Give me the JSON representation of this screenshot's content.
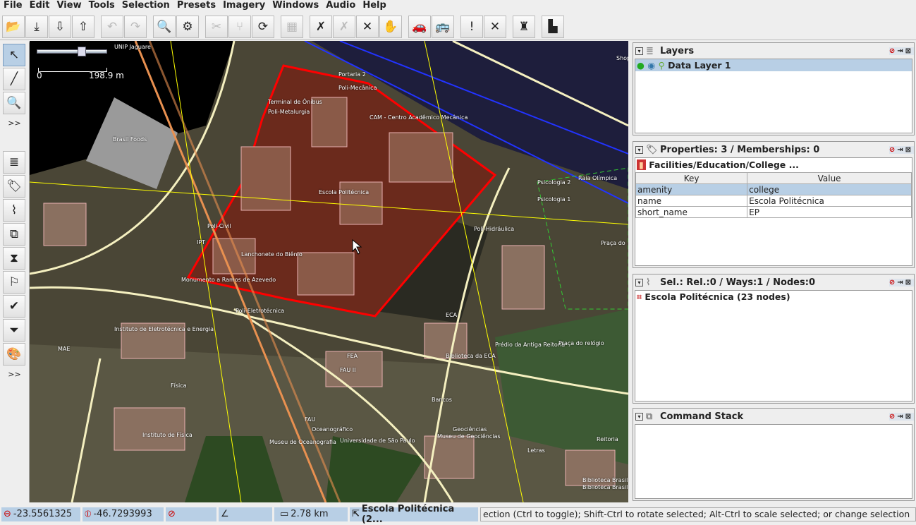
{
  "menu": [
    "File",
    "Edit",
    "View",
    "Tools",
    "Selection",
    "Presets",
    "Imagery",
    "Windows",
    "Audio",
    "Help"
  ],
  "toolbar": [
    {
      "icon": "open-file-icon",
      "g": "📂"
    },
    {
      "icon": "download-icon",
      "g": "⤓"
    },
    {
      "icon": "download-data-icon",
      "g": "⇩"
    },
    {
      "icon": "upload-icon",
      "g": "⇧"
    },
    {
      "sep": true
    },
    {
      "icon": "undo-icon",
      "g": "↶",
      "dis": true
    },
    {
      "icon": "redo-icon",
      "g": "↷",
      "dis": true
    },
    {
      "sep": true
    },
    {
      "icon": "zoom-to-data-icon",
      "g": "🔍"
    },
    {
      "icon": "preferences-icon",
      "g": "⚙"
    },
    {
      "sep": true
    },
    {
      "icon": "split-way-icon",
      "g": "✂",
      "dis": true
    },
    {
      "icon": "combine-way-icon",
      "g": "⑂",
      "dis": true
    },
    {
      "icon": "update-data-icon",
      "g": "⟳"
    },
    {
      "sep": true
    },
    {
      "icon": "disabled-icon",
      "g": "▦",
      "dis": true
    },
    {
      "sep": true
    },
    {
      "icon": "highway-icon",
      "g": "✗"
    },
    {
      "icon": "highway-grey-icon",
      "g": "✗",
      "dis": true
    },
    {
      "icon": "junction-icon",
      "g": "✕"
    },
    {
      "icon": "hand-icon",
      "g": "✋"
    },
    {
      "sep": true
    },
    {
      "icon": "car-icon",
      "g": "🚗"
    },
    {
      "icon": "bus-icon",
      "g": "🚌"
    },
    {
      "sep": true
    },
    {
      "icon": "warning-icon",
      "g": "!"
    },
    {
      "icon": "restaurant-icon",
      "g": "✕"
    },
    {
      "sep": true
    },
    {
      "icon": "castle-icon",
      "g": "♜"
    },
    {
      "sep": true
    },
    {
      "icon": "factory-icon",
      "g": "▙"
    }
  ],
  "left_toolbar": [
    {
      "icon": "select-mode-icon",
      "g": "↖",
      "sel": true
    },
    {
      "icon": "draw-mode-icon",
      "g": "╱"
    },
    {
      "icon": "zoom-mode-icon",
      "g": "🔍"
    },
    {
      "more": ">>"
    },
    {
      "icon": "layers-toggle-icon",
      "g": "≣"
    },
    {
      "icon": "properties-toggle-icon",
      "g": "🏷"
    },
    {
      "icon": "selection-list-icon",
      "g": "⌇"
    },
    {
      "icon": "relations-icon",
      "g": "⧉"
    },
    {
      "icon": "history-icon",
      "g": "⧗"
    },
    {
      "icon": "conflict-icon",
      "g": "⚐"
    },
    {
      "icon": "validator-icon",
      "g": "✔"
    },
    {
      "icon": "filter-icon",
      "g": "⏷"
    },
    {
      "icon": "map-paint-icon",
      "g": "🎨"
    },
    {
      "more": ">>"
    }
  ],
  "map": {
    "scale": {
      "zero": "0",
      "value": "198.9 m"
    },
    "labels": [
      {
        "t": "UNIP Jaguare"
      },
      {
        "t": "Brasil Foods"
      },
      {
        "t": "Portaria 2"
      },
      {
        "t": "Poli-Mecânica"
      },
      {
        "t": "Terminal de Ônibus"
      },
      {
        "t": "Poli-Metalurgia"
      },
      {
        "t": "CAM - Centro Acadêmico Mecânica"
      },
      {
        "t": "Escola Politécnica"
      },
      {
        "t": "Poli-Civil"
      },
      {
        "t": "IPT"
      },
      {
        "t": "Lanchonete do Biênio"
      },
      {
        "t": "Monumento a Ramos de Azevedo"
      },
      {
        "t": "Poli-Eletrotécnica"
      },
      {
        "t": "Instituto de Eletrotécnica e Energia"
      },
      {
        "t": "MAE"
      },
      {
        "t": "FEA"
      },
      {
        "t": "FAU II"
      },
      {
        "t": "Física"
      },
      {
        "t": "ECA"
      },
      {
        "t": "Biblioteca da ECA"
      },
      {
        "t": "Prédio da Antiga Reitoria"
      },
      {
        "t": "Praça do relógio"
      },
      {
        "t": "Psicologia 2"
      },
      {
        "t": "Psicologia 1"
      },
      {
        "t": "Poli-Hidráulica"
      },
      {
        "t": "Raia Olímpica"
      },
      {
        "t": "FAU"
      },
      {
        "t": "Oceanográfico"
      },
      {
        "t": "Museu de Oceanografia"
      },
      {
        "t": "Universidade de São Paulo"
      },
      {
        "t": "Geociências"
      },
      {
        "t": "Museu de Geociências"
      },
      {
        "t": "Bancos"
      },
      {
        "t": "Instituto de Física"
      },
      {
        "t": "Letras"
      },
      {
        "t": "Reitoria"
      },
      {
        "t": "Biblioteca Brasiliana"
      },
      {
        "t": "Biblioteca Brasiliana"
      },
      {
        "t": "Praça do"
      },
      {
        "t": "Shopping"
      }
    ]
  },
  "panels": {
    "layers": {
      "title": "Layers",
      "items": [
        "Data Layer 1"
      ]
    },
    "properties": {
      "title": "Properties: 3 / Memberships: 0",
      "preset": "Facilities/Education/College ...",
      "headers": [
        "Key",
        "Value"
      ],
      "rows": [
        {
          "k": "amenity",
          "v": "college"
        },
        {
          "k": "name",
          "v": "Escola Politécnica"
        },
        {
          "k": "short_name",
          "v": "EP"
        }
      ]
    },
    "selection": {
      "title": "Sel.: Rel.:0 / Ways:1 / Nodes:0",
      "items": [
        "Escola Politécnica (23 nodes)"
      ]
    },
    "command_stack": {
      "title": "Command Stack"
    }
  },
  "status": {
    "lat": "-23.5561325",
    "lon": "-46.7293993",
    "heading": "",
    "angle": "",
    "distance": "2.78 km",
    "name": "Escola Politécnica (2...",
    "message": "ection (Ctrl to toggle); Shift-Ctrl to rotate selected; Alt-Ctrl to scale selected; or change selection"
  },
  "colors": {
    "selection": "#ff0000",
    "nodes": "#ffff00",
    "buildings": "#e8b0b0",
    "map_bg": "#4a4636",
    "panel_highlight": "#b8cfe5"
  }
}
